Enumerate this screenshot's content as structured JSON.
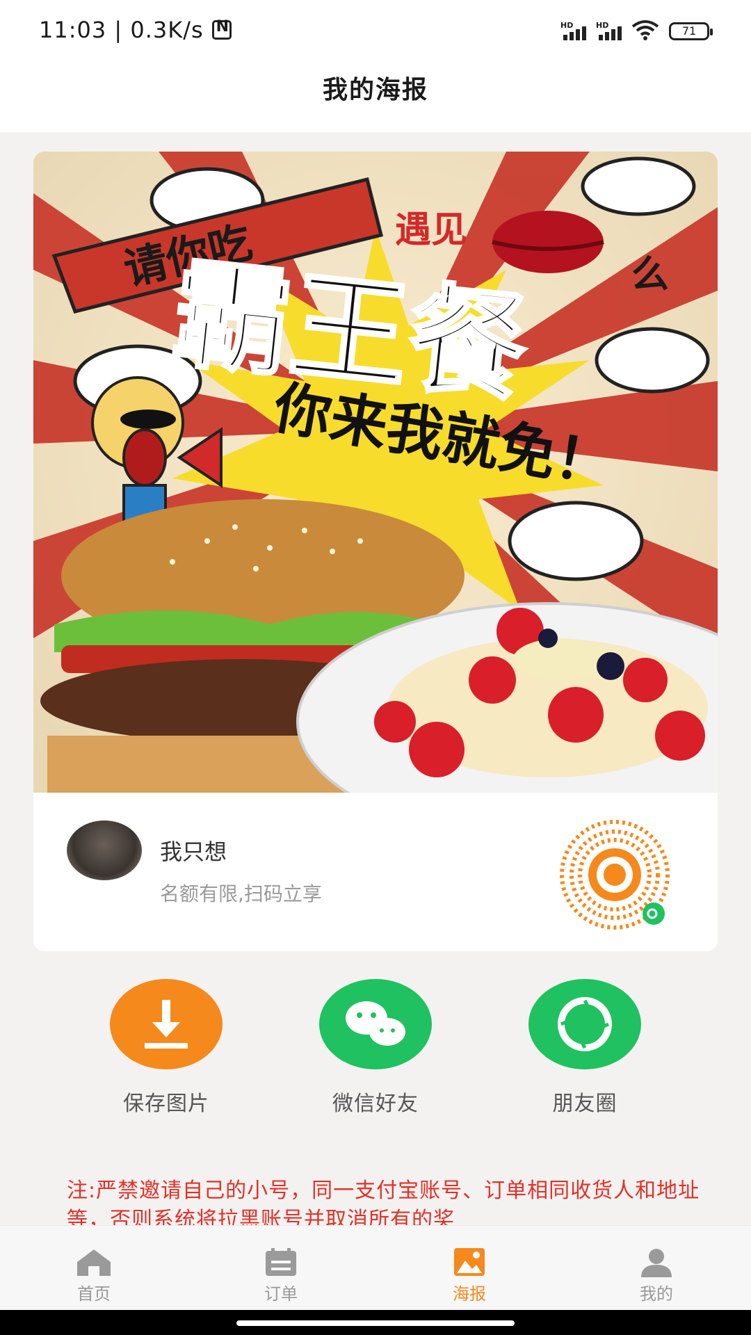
{
  "status_bar": {
    "time_speed": "11:03 | 0.3K/s",
    "net1": "HD",
    "net2": "HD",
    "battery": "71"
  },
  "header": {
    "title": "我的海报"
  },
  "poster": {
    "banner_text": "请你吃",
    "tagline_top": "遇见",
    "tagline_top_suffix": "么",
    "headline": "霸王餐",
    "slogan": "你来我就免！",
    "username": "我只想",
    "subtitle": "名额有限,扫码立享",
    "qrcode_icon": "mini-program-qr-icon"
  },
  "share": {
    "save_label": "保存图片",
    "wechat_label": "微信好友",
    "moments_label": "朋友圈"
  },
  "notice": "注:严禁邀请自己的小号，同一支付宝账号、订单相同收货人和地址等，否则系统将拉黑账号并取消所有的奖",
  "nav": {
    "home": "首页",
    "orders": "订单",
    "poster": "海报",
    "mine": "我的"
  },
  "colors": {
    "accent": "#f5891c",
    "wechat_green": "#1fc160",
    "notice_red": "#e0312a"
  }
}
